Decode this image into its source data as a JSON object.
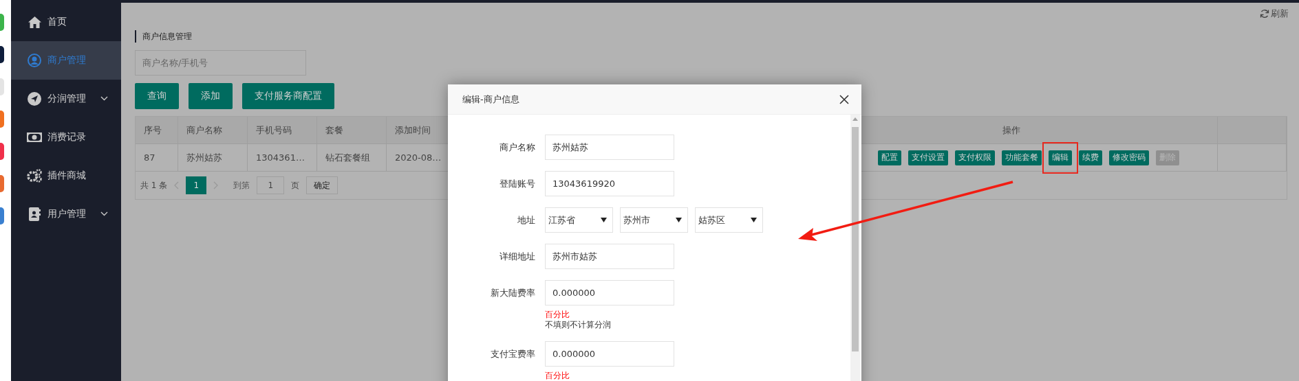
{
  "sidebar": {
    "items": [
      {
        "label": "首页",
        "selected": false,
        "expandable": false
      },
      {
        "label": "商户管理",
        "selected": true,
        "expandable": false
      },
      {
        "label": "分润管理",
        "selected": false,
        "expandable": true
      },
      {
        "label": "消费记录",
        "selected": false,
        "expandable": false
      },
      {
        "label": "插件商城",
        "selected": false,
        "expandable": false
      },
      {
        "label": "用户管理",
        "selected": false,
        "expandable": true
      }
    ]
  },
  "toolbar": {
    "refresh": "刷新"
  },
  "page": {
    "title": "商户信息管理",
    "search": {
      "placeholder": "商户名称/手机号"
    },
    "buttons": [
      "查询",
      "添加",
      "支付服务商配置"
    ]
  },
  "table": {
    "columns": [
      "序号",
      "商户名称",
      "手机号码",
      "套餐",
      "添加时间",
      "操作"
    ],
    "rows": [
      {
        "cells": [
          "87",
          "苏州姑苏",
          "1304361…",
          "钻石套餐组",
          "2020-08…"
        ],
        "actions": [
          {
            "label": "配置",
            "disabled": false,
            "highlighted": false
          },
          {
            "label": "支付设置",
            "disabled": false,
            "highlighted": false
          },
          {
            "label": "支付权限",
            "disabled": false,
            "highlighted": false
          },
          {
            "label": "功能套餐",
            "disabled": false,
            "highlighted": false
          },
          {
            "label": "编辑",
            "disabled": false,
            "highlighted": true
          },
          {
            "label": "续费",
            "disabled": false,
            "highlighted": false
          },
          {
            "label": "修改密码",
            "disabled": false,
            "highlighted": false
          },
          {
            "label": "删除",
            "disabled": true,
            "highlighted": false
          }
        ]
      }
    ]
  },
  "pagination": {
    "total": "共 1 条",
    "pages": [
      {
        "label": "1",
        "selected": true
      }
    ],
    "goto_label": "到第",
    "goto_value": "1",
    "page_unit": "页",
    "confirm": "确定"
  },
  "dialog": {
    "title": "编辑-商户信息",
    "fields": [
      {
        "kind": "text",
        "label": "商户名称",
        "value": "苏州姑苏"
      },
      {
        "kind": "text",
        "label": "登陆账号",
        "value": "13043619920"
      },
      {
        "kind": "select",
        "label": "地址",
        "options": [
          "江苏省",
          "苏州市",
          "姑苏区"
        ]
      },
      {
        "kind": "text",
        "label": "详细地址",
        "value": "苏州市姑苏"
      },
      {
        "kind": "text",
        "label": "新大陆费率",
        "value": "0.000000",
        "unit": "百分比",
        "note": "不填则不计算分润"
      },
      {
        "kind": "text",
        "label": "支付宝费率",
        "value": "0.000000",
        "unit": "百分比"
      }
    ]
  }
}
